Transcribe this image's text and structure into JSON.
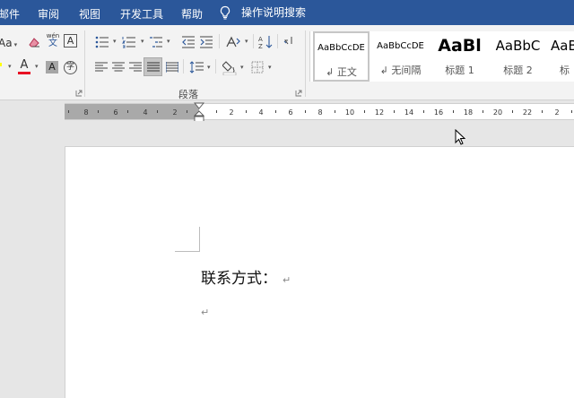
{
  "menu": {
    "tabs": [
      "邮件",
      "审阅",
      "视图",
      "开发工具",
      "帮助"
    ],
    "tell_me": "操作说明搜索"
  },
  "ribbon": {
    "font": {
      "font_size_dropdown": "Aa",
      "phonetic_top": "wén",
      "phonetic_bottom": "文",
      "char_border": "A",
      "font_color": "A",
      "char_shading": "A",
      "enclose_char": "字"
    },
    "paragraph": {
      "label": "段落"
    },
    "styles": [
      {
        "sample": "AaBbCcDĖ",
        "name": "↲ 正文",
        "selected": true
      },
      {
        "sample": "AaBbCcDĖ",
        "name": "↲ 无间隔",
        "selected": false
      },
      {
        "sample": "AaBl",
        "name": "标题 1",
        "selected": false
      },
      {
        "sample": "AaBbC",
        "name": "标题 2",
        "selected": false
      },
      {
        "sample": "AaB",
        "name": "标",
        "selected": false
      }
    ],
    "colors": {
      "highlight": "#ffff00",
      "font_color": "#e81123",
      "accent": "#2b579a"
    }
  },
  "ruler": {
    "left_labels": [
      "8",
      "6",
      "4",
      "2"
    ],
    "right_labels": [
      "2",
      "4",
      "6",
      "8",
      "10",
      "12",
      "14",
      "16",
      "18",
      "20",
      "22",
      "2"
    ]
  },
  "document": {
    "line1": "联系方式：",
    "para_mark": "↵"
  }
}
